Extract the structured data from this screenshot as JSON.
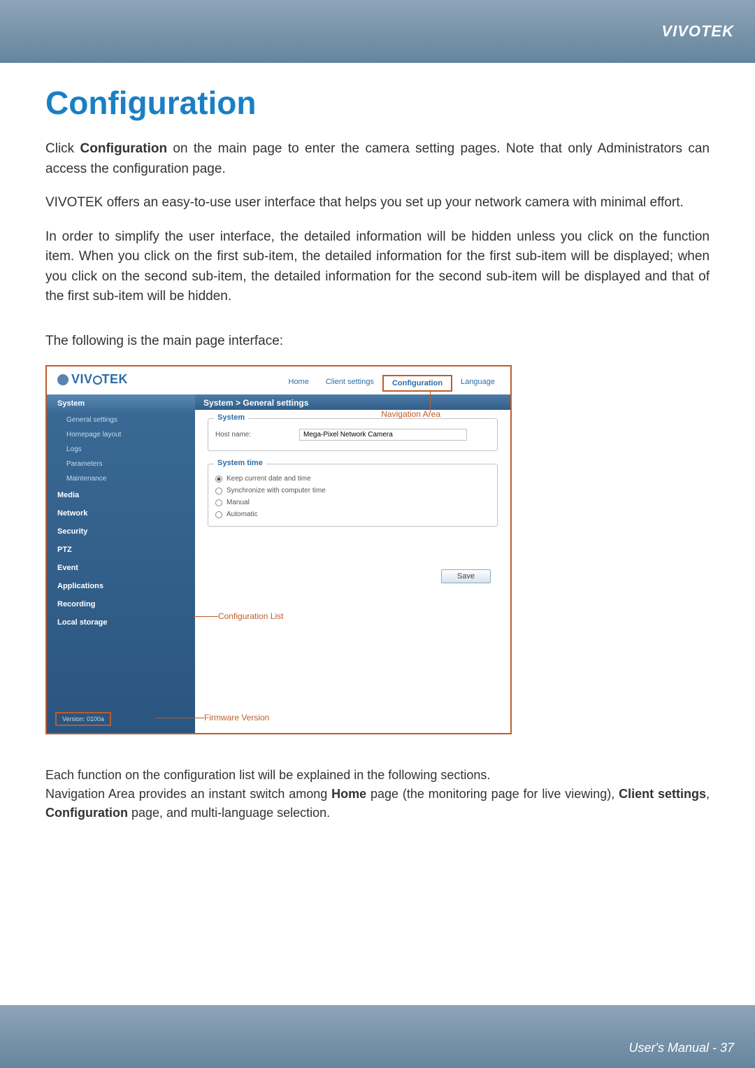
{
  "brand": "VIVOTEK",
  "page": {
    "title": "Configuration",
    "intro1_a": "Click ",
    "intro1_b": "Configuration",
    "intro1_c": " on the main page to enter the camera setting pages. Note that only Administrators can access the configuration page.",
    "intro2": "VIVOTEK offers an easy-to-use user interface that helps you set up your network camera with minimal effort.",
    "intro3": "In order to simplify the user interface, the detailed information will be hidden unless you click on the function item. When you click on the first sub-item, the detailed information for the first sub-item will be displayed; when you click on the second sub-item, the detailed information for the second sub-item will be displayed and that of the first sub-item will be hidden.",
    "intro4": "The following is the main page interface:",
    "footnote1": "Each function on the configuration list will be explained in the following sections.",
    "footnote2_a": "Navigation Area provides an instant switch among ",
    "footnote2_b": "Home",
    "footnote2_c": " page (the monitoring page for live viewing), ",
    "footnote2_d": "Client settings",
    "footnote2_e": ", ",
    "footnote2_f": "Configuration",
    "footnote2_g": " page, and multi-language selection."
  },
  "screenshot": {
    "logo": "VIVOTEK",
    "topnav": {
      "home": "Home",
      "client": "Client settings",
      "config": "Configuration",
      "lang": "Language"
    },
    "breadcrumb": "System  >  General settings",
    "sidebar": {
      "system": "System",
      "general": "General settings",
      "homepage": "Homepage layout",
      "logs": "Logs",
      "parameters": "Parameters",
      "maintenance": "Maintenance",
      "media": "Media",
      "network": "Network",
      "security": "Security",
      "ptz": "PTZ",
      "event": "Event",
      "applications": "Applications",
      "recording": "Recording",
      "localstorage": "Local storage",
      "version": "Version: 0100a"
    },
    "main": {
      "system_legend": "System",
      "hostname_label": "Host name:",
      "hostname_value": "Mega-Pixel Network Camera",
      "systemtime_legend": "System time",
      "keep_current": "Keep current date and time",
      "sync_computer": "Synchronize with computer time",
      "manual": "Manual",
      "automatic": "Automatic",
      "save": "Save"
    },
    "annotations": {
      "nav_area": "Navigation Area",
      "config_list": "Configuration List",
      "firmware": "Firmware Version"
    }
  },
  "footer": {
    "text": "User's Manual - 37"
  }
}
